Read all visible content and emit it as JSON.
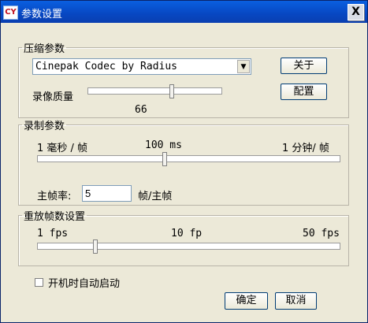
{
  "window": {
    "icon_text": "CY",
    "title": "参数设置",
    "close": "X"
  },
  "compression": {
    "legend": "压缩参数",
    "codec_value": "Cinepak Codec by Radius",
    "about_label": "关于",
    "config_label": "配置",
    "quality_label": "录像质量",
    "quality_value": "66",
    "quality_level_fraction": 0.66
  },
  "recording": {
    "legend": "录制参数",
    "min_label": "1 毫秒 / 帧",
    "mid_label": "100 ms",
    "max_label": "1 分钟/ 帧",
    "keyframe_label": "主帧率:",
    "keyframe_value": "5",
    "keyframe_unit": "帧/主帧"
  },
  "playback": {
    "legend": "重放帧数设置",
    "min_label": "1 fps",
    "mid_label": "10 fp",
    "max_label": "50 fps"
  },
  "startup": {
    "label": "开机时自动启动",
    "checked": false
  },
  "footer": {
    "ok_label": "确定",
    "cancel_label": "取消"
  }
}
